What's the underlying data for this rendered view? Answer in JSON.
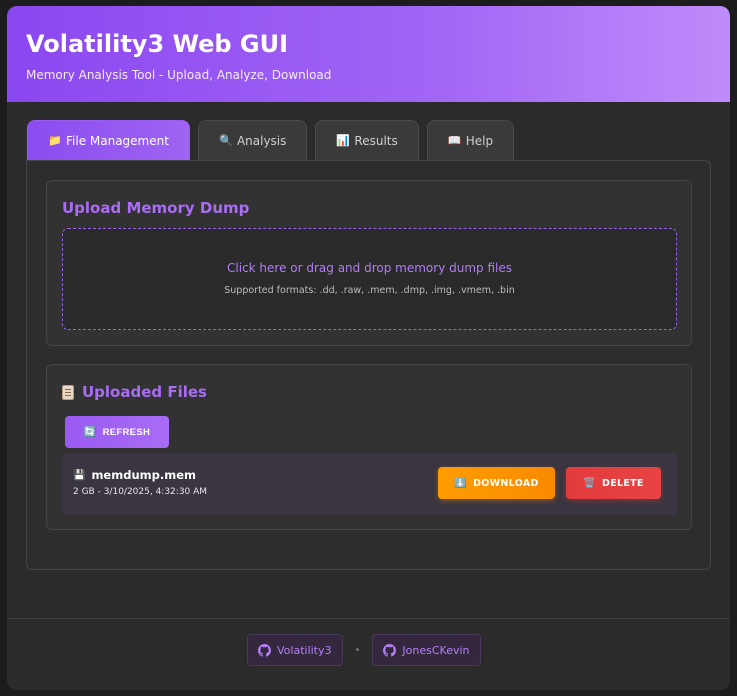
{
  "header": {
    "title": "Volatility3 Web GUI",
    "subtitle": "Memory Analysis Tool - Upload, Analyze, Download"
  },
  "tabs": [
    {
      "icon": "folder-icon",
      "glyph": "📁",
      "label": "File Management",
      "active": true
    },
    {
      "icon": "magnifier-icon",
      "glyph": "🔍",
      "label": "Analysis",
      "active": false
    },
    {
      "icon": "bar-chart-icon",
      "glyph": "📊",
      "label": "Results",
      "active": false
    },
    {
      "icon": "book-icon",
      "glyph": "📖",
      "label": "Help",
      "active": false
    }
  ],
  "upload": {
    "title": "Upload Memory Dump",
    "drop_text": "Click here or drag and drop memory dump files",
    "formats_text": "Supported formats: .dd, .raw, .mem, .dmp, .img, .vmem, .bin"
  },
  "files": {
    "title": "Uploaded Files",
    "refresh_label": "REFRESH",
    "items": [
      {
        "name": "memdump.mem",
        "meta": "2 GB - 3/10/2025, 4:32:30 AM",
        "download_label": "DOWNLOAD",
        "delete_label": "DELETE"
      }
    ]
  },
  "footer": {
    "links": [
      "Volatility3",
      "JonesCKevin"
    ],
    "separator": "•"
  },
  "colors": {
    "accent": "#a96cf5",
    "header_start": "#8b47f0",
    "header_end": "#c08bfa",
    "download": "#ff9d00",
    "delete": "#e23b3b",
    "background": "#2b2b2b"
  }
}
